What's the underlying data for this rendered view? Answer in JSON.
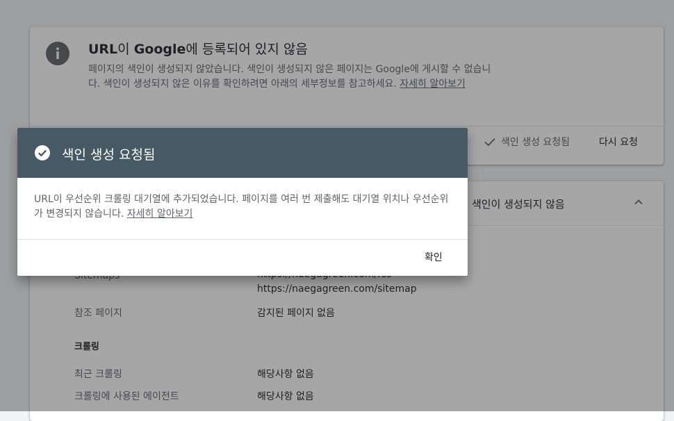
{
  "status": {
    "title_url": "URL",
    "title_mid": "이 ",
    "title_google": "Google",
    "title_end": "에 등록되어 있지 않음",
    "description": "페이지의 색인이 생성되지 않았습니다. 색인이 생성되지 않은 페이지는 Google에 게시할 수 없습니다. 색인이 생성되지 않은 이유를 확인하려면 아래의 세부정보를 참고하세요.",
    "learn_more": "자세히 알아보기",
    "requested_label": "색인 생성 요청됨",
    "request_again_label": "다시 요청"
  },
  "details": {
    "coverage_label": "색인이 생성되지 않음",
    "sitemaps_label": "Sitemaps",
    "sitemaps_values": [
      "https://naegagreen.com/rss",
      "https://naegagreen.com/sitemap"
    ],
    "referring_label": "참조 페이지",
    "referring_value": "감지된 페이지 없음",
    "crawl_heading": "크롤링",
    "last_crawl_label": "최근 크롤링",
    "last_crawl_value": "해당사항 없음",
    "crawl_agent_label": "크롤링에 사용된 에이전트",
    "crawl_agent_value": "해당사항 없음"
  },
  "dialog": {
    "title": "색인 생성 요청됨",
    "body": "URL이 우선순위 크롤링 대기열에 추가되었습니다. 페이지를 여러 번 제출해도 대기열 위치나 우선순위가 변경되지 않습니다.",
    "learn_more": "자세히 알아보기",
    "ok_label": "확인"
  },
  "colors": {
    "dialog_header": "#455a64",
    "overlay": "#202124"
  },
  "icons": {
    "info": "info-icon",
    "check": "check-icon",
    "check_circle": "check-circle-icon",
    "chevron": "chevron-up-icon"
  }
}
